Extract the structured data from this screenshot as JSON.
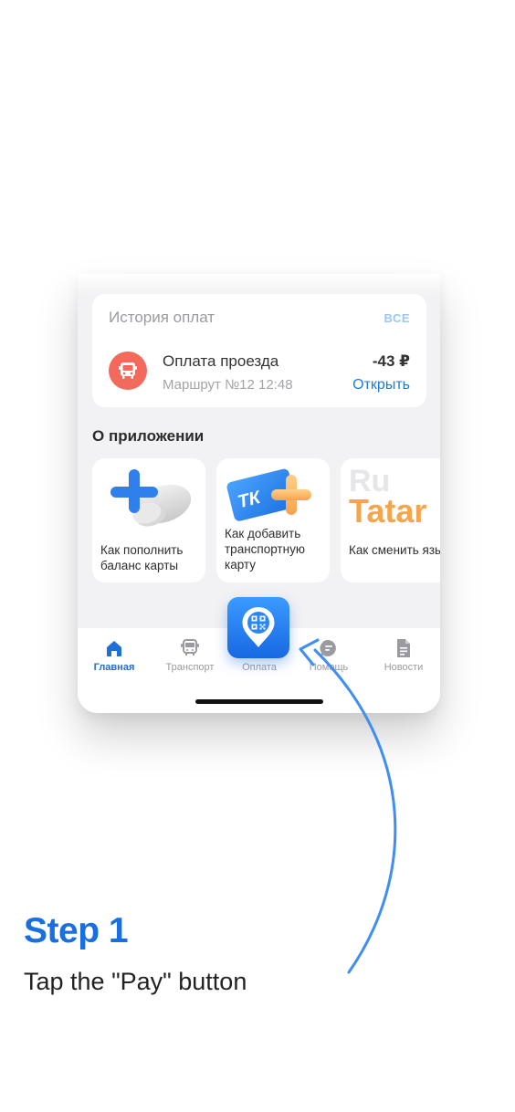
{
  "history": {
    "title": "История оплат",
    "all_link": "ВСЕ",
    "transaction": {
      "icon": "bus-icon",
      "title": "Оплата проезда",
      "subtitle": "Маршрут №12  12:48",
      "amount": "-43 ₽",
      "open_link": "Открыть"
    }
  },
  "about": {
    "title": "О приложении",
    "cards": [
      {
        "label": "Как пополнить баланс карты",
        "icon": "topup-coins-icon"
      },
      {
        "label": "Как добавить транспортную карту",
        "icon": "transport-card-plus-icon"
      },
      {
        "label": "Как сменить язык",
        "icon": "language-icon",
        "art_text_top": "Ru",
        "art_text_bottom": "Tatar"
      }
    ]
  },
  "tabbar": {
    "tabs": [
      {
        "label": "Главная",
        "icon": "home-icon",
        "active": true
      },
      {
        "label": "Транспорт",
        "icon": "bus-icon",
        "active": false
      },
      {
        "label": "Оплата",
        "icon": "qr-pin-icon",
        "active": false
      },
      {
        "label": "Помощь",
        "icon": "chat-icon",
        "active": false
      },
      {
        "label": "Новости",
        "icon": "document-icon",
        "active": false
      }
    ]
  },
  "step": {
    "title": "Step 1",
    "text": "Tap the \"Pay\" button"
  },
  "colors": {
    "accent": "#1f7ae0",
    "step_title": "#1a6fe0",
    "tx_icon_bg": "#f26a5b",
    "pay_button": "#2a86f2"
  }
}
